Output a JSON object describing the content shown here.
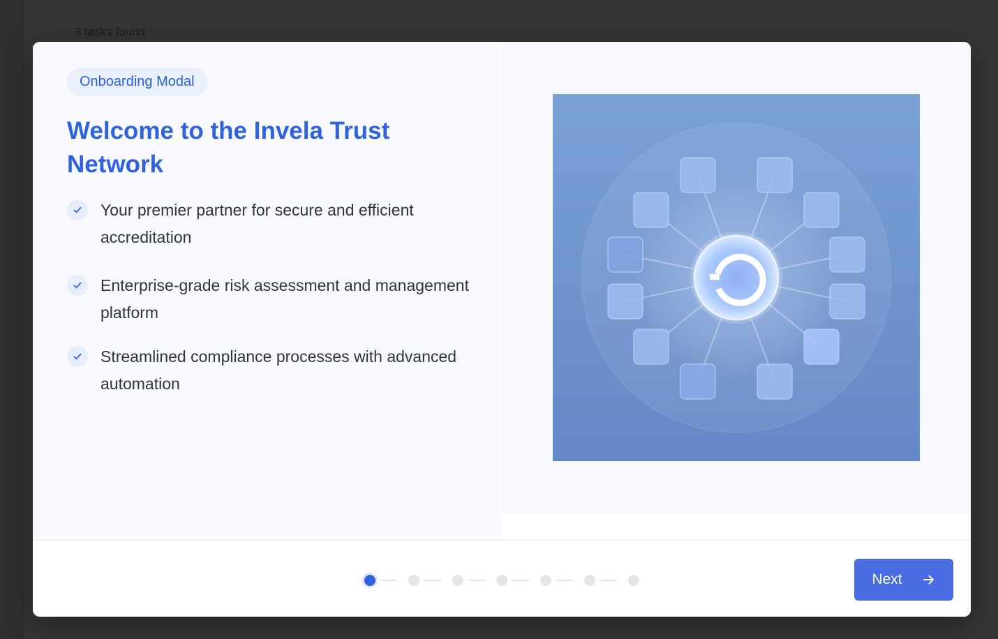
{
  "background": {
    "task_count_text": "3 tasks found"
  },
  "modal": {
    "badge": "Onboarding Modal",
    "title": "Welcome to the Invela Trust Network",
    "features": [
      "Your premier partner for secure and efficient accreditation",
      "Enterprise-grade risk assessment and management platform",
      "Streamlined compliance processes with advanced automation"
    ],
    "illustration_icon": "network-hub-illustration",
    "stepper": {
      "total_steps": 7,
      "current_step": 1
    },
    "next_button": {
      "label": "Next",
      "icon": "arrow-right-icon"
    }
  },
  "colors": {
    "accent": "#2f62dd",
    "button": "#4a6ce2",
    "badge_bg": "#e8f0fc",
    "illustration_bg": "#7096cf"
  }
}
